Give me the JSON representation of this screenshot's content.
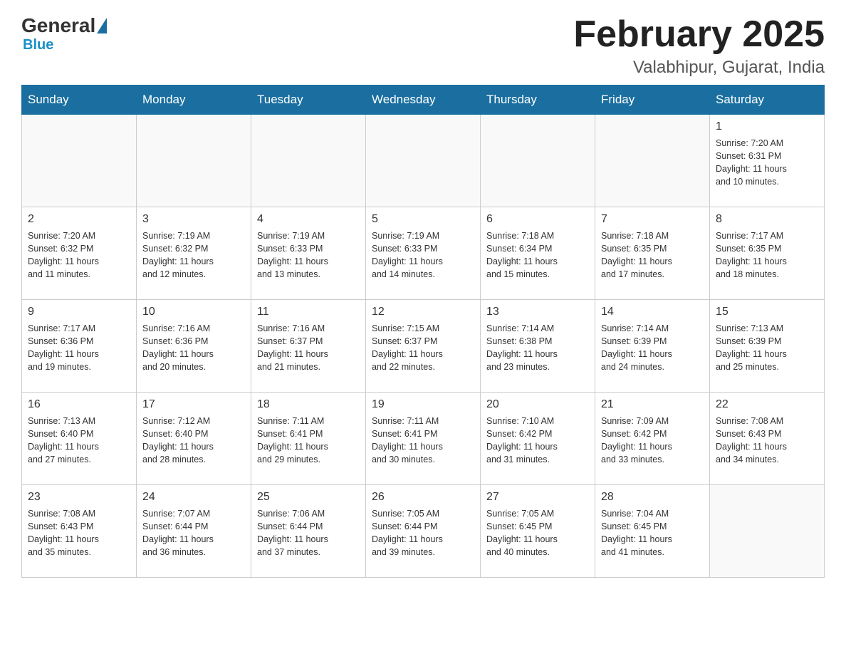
{
  "header": {
    "logo": {
      "general": "General",
      "blue": "Blue"
    },
    "title": "February 2025",
    "subtitle": "Valabhipur, Gujarat, India"
  },
  "days_of_week": [
    "Sunday",
    "Monday",
    "Tuesday",
    "Wednesday",
    "Thursday",
    "Friday",
    "Saturday"
  ],
  "weeks": [
    [
      {
        "day": "",
        "info": ""
      },
      {
        "day": "",
        "info": ""
      },
      {
        "day": "",
        "info": ""
      },
      {
        "day": "",
        "info": ""
      },
      {
        "day": "",
        "info": ""
      },
      {
        "day": "",
        "info": ""
      },
      {
        "day": "1",
        "info": "Sunrise: 7:20 AM\nSunset: 6:31 PM\nDaylight: 11 hours\nand 10 minutes."
      }
    ],
    [
      {
        "day": "2",
        "info": "Sunrise: 7:20 AM\nSunset: 6:32 PM\nDaylight: 11 hours\nand 11 minutes."
      },
      {
        "day": "3",
        "info": "Sunrise: 7:19 AM\nSunset: 6:32 PM\nDaylight: 11 hours\nand 12 minutes."
      },
      {
        "day": "4",
        "info": "Sunrise: 7:19 AM\nSunset: 6:33 PM\nDaylight: 11 hours\nand 13 minutes."
      },
      {
        "day": "5",
        "info": "Sunrise: 7:19 AM\nSunset: 6:33 PM\nDaylight: 11 hours\nand 14 minutes."
      },
      {
        "day": "6",
        "info": "Sunrise: 7:18 AM\nSunset: 6:34 PM\nDaylight: 11 hours\nand 15 minutes."
      },
      {
        "day": "7",
        "info": "Sunrise: 7:18 AM\nSunset: 6:35 PM\nDaylight: 11 hours\nand 17 minutes."
      },
      {
        "day": "8",
        "info": "Sunrise: 7:17 AM\nSunset: 6:35 PM\nDaylight: 11 hours\nand 18 minutes."
      }
    ],
    [
      {
        "day": "9",
        "info": "Sunrise: 7:17 AM\nSunset: 6:36 PM\nDaylight: 11 hours\nand 19 minutes."
      },
      {
        "day": "10",
        "info": "Sunrise: 7:16 AM\nSunset: 6:36 PM\nDaylight: 11 hours\nand 20 minutes."
      },
      {
        "day": "11",
        "info": "Sunrise: 7:16 AM\nSunset: 6:37 PM\nDaylight: 11 hours\nand 21 minutes."
      },
      {
        "day": "12",
        "info": "Sunrise: 7:15 AM\nSunset: 6:37 PM\nDaylight: 11 hours\nand 22 minutes."
      },
      {
        "day": "13",
        "info": "Sunrise: 7:14 AM\nSunset: 6:38 PM\nDaylight: 11 hours\nand 23 minutes."
      },
      {
        "day": "14",
        "info": "Sunrise: 7:14 AM\nSunset: 6:39 PM\nDaylight: 11 hours\nand 24 minutes."
      },
      {
        "day": "15",
        "info": "Sunrise: 7:13 AM\nSunset: 6:39 PM\nDaylight: 11 hours\nand 25 minutes."
      }
    ],
    [
      {
        "day": "16",
        "info": "Sunrise: 7:13 AM\nSunset: 6:40 PM\nDaylight: 11 hours\nand 27 minutes."
      },
      {
        "day": "17",
        "info": "Sunrise: 7:12 AM\nSunset: 6:40 PM\nDaylight: 11 hours\nand 28 minutes."
      },
      {
        "day": "18",
        "info": "Sunrise: 7:11 AM\nSunset: 6:41 PM\nDaylight: 11 hours\nand 29 minutes."
      },
      {
        "day": "19",
        "info": "Sunrise: 7:11 AM\nSunset: 6:41 PM\nDaylight: 11 hours\nand 30 minutes."
      },
      {
        "day": "20",
        "info": "Sunrise: 7:10 AM\nSunset: 6:42 PM\nDaylight: 11 hours\nand 31 minutes."
      },
      {
        "day": "21",
        "info": "Sunrise: 7:09 AM\nSunset: 6:42 PM\nDaylight: 11 hours\nand 33 minutes."
      },
      {
        "day": "22",
        "info": "Sunrise: 7:08 AM\nSunset: 6:43 PM\nDaylight: 11 hours\nand 34 minutes."
      }
    ],
    [
      {
        "day": "23",
        "info": "Sunrise: 7:08 AM\nSunset: 6:43 PM\nDaylight: 11 hours\nand 35 minutes."
      },
      {
        "day": "24",
        "info": "Sunrise: 7:07 AM\nSunset: 6:44 PM\nDaylight: 11 hours\nand 36 minutes."
      },
      {
        "day": "25",
        "info": "Sunrise: 7:06 AM\nSunset: 6:44 PM\nDaylight: 11 hours\nand 37 minutes."
      },
      {
        "day": "26",
        "info": "Sunrise: 7:05 AM\nSunset: 6:44 PM\nDaylight: 11 hours\nand 39 minutes."
      },
      {
        "day": "27",
        "info": "Sunrise: 7:05 AM\nSunset: 6:45 PM\nDaylight: 11 hours\nand 40 minutes."
      },
      {
        "day": "28",
        "info": "Sunrise: 7:04 AM\nSunset: 6:45 PM\nDaylight: 11 hours\nand 41 minutes."
      },
      {
        "day": "",
        "info": ""
      }
    ]
  ]
}
